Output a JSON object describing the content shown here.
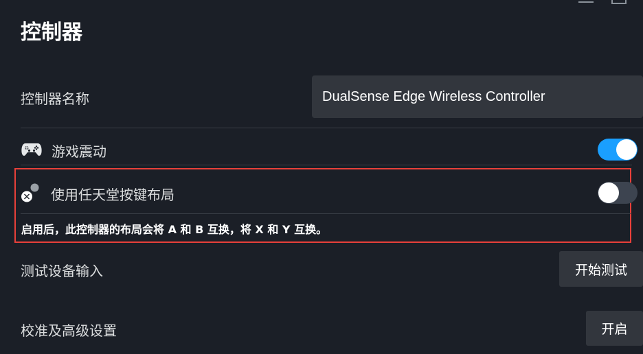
{
  "page": {
    "title": "控制器"
  },
  "controller_name": {
    "label": "控制器名称",
    "value": "DualSense Edge Wireless Controller"
  },
  "rumble": {
    "label": "游戏震动",
    "icon": "gamepad-icon",
    "enabled": true
  },
  "nintendo_layout": {
    "label": "使用任天堂按键布局",
    "icon": "face-buttons-icon",
    "enabled": false,
    "description": "启用后，此控制器的布局会将 A 和 B 互换，将 X 和 Y 互换。"
  },
  "test_input": {
    "label": "测试设备输入",
    "button_label": "开始测试"
  },
  "calibration": {
    "label": "校准及高级设置",
    "button_label": "开启"
  },
  "colors": {
    "background": "#1b1f27",
    "toggle_on": "#1a9fff",
    "toggle_off": "#3d4450",
    "highlight": "#e8403a"
  }
}
